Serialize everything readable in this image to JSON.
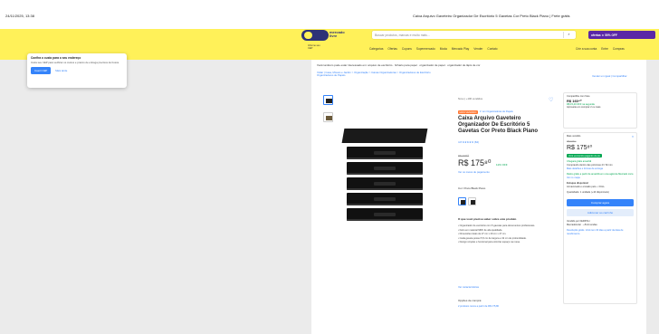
{
  "timestamp": "24/11/2025, 13:38",
  "page_title": "Caixa Arquivo Gaveteiro Organizador De Escritório 5 Gavetas Cor Preto Black Piano | Frete grátis",
  "header": {
    "logo_line1": "mercado",
    "logo_line2": "livre",
    "search_placeholder": "Buscar produtos, marcas e muito mais…",
    "promo_text": "ofertas ★ 50% OFF",
    "location_line1": "Informe seu",
    "location_line2": "CEP",
    "nav": [
      "Categorias",
      "Ofertas",
      "Cupons",
      "Supermercado",
      "Moda",
      "Mercado Play",
      "Vender",
      "Contato"
    ],
    "nav_right": [
      "Crie a sua conta",
      "Entre",
      "Compras"
    ]
  },
  "cookie": {
    "title": "Confira o custo para o seu endereço",
    "text": "Insira seu CEP para verificar os custos e prazos de entrega precisos de busca.",
    "primary": "Inserir CEP",
    "secondary": "Mais tarde"
  },
  "related": "Você também pode estar interessado em: arquivo de escritório · fichario para papel · organizador de papel · organizador de lápis de cor",
  "breadcrumb_line1": "Voltar  |  Casa, Móveis e Jardim  >  Organização  >  Caixas Organizadoras  >  Organizadores de Escritório",
  "breadcrumb_line2": "Organizadores de Papéis",
  "breadcrumb_right": "Vender um igual  |  Compartilhar",
  "product": {
    "condition": "Novo | +100 vendidos",
    "badge": "MAIS VENDIDO",
    "badge_text": "1º em Organizadores de Papéis",
    "title": "Caixa Arquivo Gaveteiro Organizador De Escritório 5 Gavetas Cor Preto Black Piano",
    "rating": "4.8 ★★★★★ (84)",
    "old_price": "R$ 199⁰⁰",
    "price": "R$ 175⁸⁰",
    "discount": "11% OFF",
    "installments": "Ver os meios de pagamento",
    "color_label": "Cor: Preto Black Piano",
    "about_title": "O que você precisa saber sobre este produto",
    "bullets": [
      "Organizador de escritório com 5 gavetas para documentos profissionais.",
      "Feito em material MDF de alta qualidade.",
      "Dimensões totais de 27 cm x 29 cm x 27 cm.",
      "Cada gaveta possui 5,5 cm de largura e 32 cm de profundidade.",
      "Design simples e funcional para otimizar espaço na mesa."
    ],
    "more_link": "Ver características",
    "opts_title": "Opções de compra:",
    "opts_link": "2 produtos novos a partir de R$ 175,80"
  },
  "side_promo": {
    "line1": "Compartilhe com frete",
    "price": "R$ 160⁴⁰",
    "line3": "R$ 15,40 OFF na segunda",
    "line4": "Aproveite em comprar 2 ou mais"
  },
  "buy_box": {
    "close": "×",
    "label": "Mais vendido",
    "old_price": "R$ 199⁰⁰",
    "price": "R$ 175⁸⁰",
    "tag": "Você economiza pagando via pix",
    "free_ship": "Chegará grátis amanhã",
    "ship_desc": "Comprando dentro das próximas 4 h 52 min",
    "ship_link": "Mais detalhes e formas de entrega",
    "pickup": "Retire grátis a partir de amanhã em uma agência Mercado Livre",
    "pickup_link": "Ver no mapa",
    "stock": "Estoque disponível",
    "stock_desc": "Armazenado e enviado pelo ⚡ FULL",
    "qty": "Quantidade: 1 unidade   (+10 disponíveis)",
    "buy_button": "Comprar agora",
    "cart_button": "Adicionar ao carrinho",
    "seller_line1": "Vendido por FERPOLI",
    "seller_line2": "MercadoLíder · +5mil vendas",
    "return": "Devolução grátis. Você tem 30 dias a partir da data de recebimento."
  }
}
